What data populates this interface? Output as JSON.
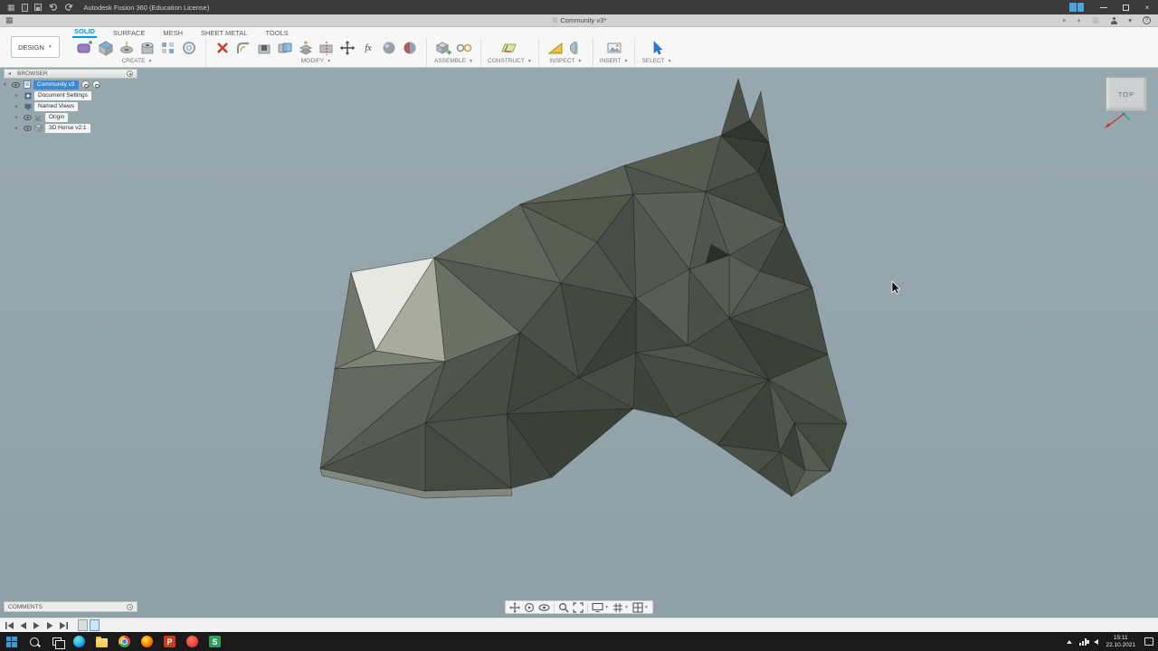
{
  "colors": {
    "accent_blue": "#0696d7",
    "viewport_bg": "#93a4aa",
    "titlebar_bg": "#3a3a3a",
    "taskbar_bg": "#1a1a1a",
    "selection_blue": "#3d87d8"
  },
  "title_bar": {
    "title": "Autodesk Fusion 360 (Education License)"
  },
  "tab_bar": {
    "document_tab": "Community v3*"
  },
  "toolbar": {
    "design_menu": "DESIGN",
    "tabs": [
      {
        "label": "SOLID",
        "active": true
      },
      {
        "label": "SURFACE",
        "active": false
      },
      {
        "label": "MESH",
        "active": false
      },
      {
        "label": "SHEET METAL",
        "active": false
      },
      {
        "label": "TOOLS",
        "active": false
      }
    ],
    "groups": [
      {
        "label": "CREATE"
      },
      {
        "label": "MODIFY"
      },
      {
        "label": "ASSEMBLE"
      },
      {
        "label": "CONSTRUCT"
      },
      {
        "label": "INSPECT"
      },
      {
        "label": "INSERT"
      },
      {
        "label": "SELECT"
      }
    ]
  },
  "browser": {
    "header": "BROWSER",
    "items": [
      {
        "label": "Community v3",
        "selected": true
      },
      {
        "label": "Document Settings",
        "selected": false
      },
      {
        "label": "Named Views",
        "selected": false
      },
      {
        "label": "Origin",
        "selected": false
      },
      {
        "label": "3D Horse v2:1",
        "selected": false
      }
    ]
  },
  "comments_panel": {
    "header": "COMMENTS"
  },
  "viewcube": {
    "face_label": "TOP"
  },
  "taskbar": {
    "time": "15:11",
    "date": "22.10.2021",
    "icons": [
      "start",
      "search",
      "task-view",
      "edge",
      "file-explorer",
      "chrome",
      "firefox",
      "powerpoint",
      "opera",
      "screen-recorder"
    ]
  },
  "navbar_icons": [
    "pan",
    "orbit",
    "look-at",
    "zoom",
    "fit",
    "display-settings",
    "grid-settings",
    "viewports"
  ]
}
